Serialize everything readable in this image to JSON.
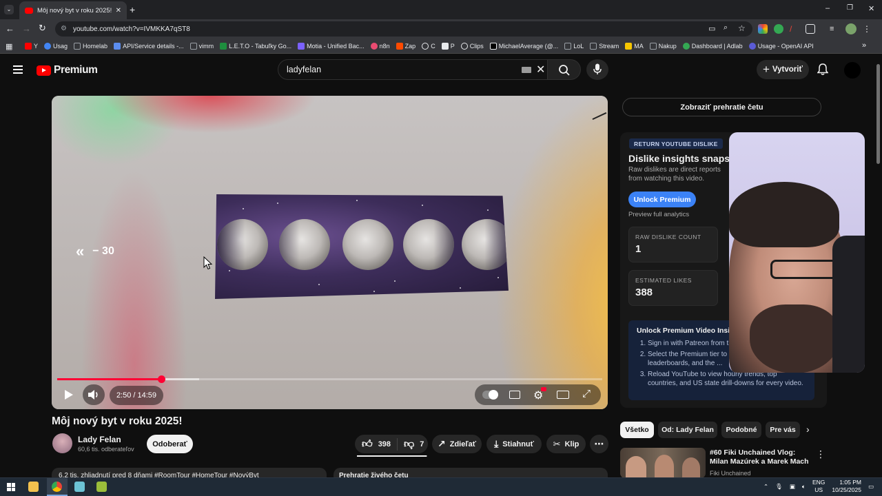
{
  "browser": {
    "tab_title": "Môj nový byt v roku 2025! - YouTube",
    "url": "youtube.com/watch?v=IVMKKA7qST8",
    "bookmarks": [
      {
        "label": "Y",
        "color": "#ff0000"
      },
      {
        "label": "Usag",
        "color": "#4285f4"
      },
      {
        "label": "Homelab",
        "color": "#9aa0a6"
      },
      {
        "label": "API/Service details -...",
        "color": "#5b8def"
      },
      {
        "label": "vimm",
        "color": "#9aa0a6"
      },
      {
        "label": "L.E.T.O - Tabuľky Go...",
        "color": "#1e8e3e"
      },
      {
        "label": "Motia - Unified Bac...",
        "color": "#7b61ff"
      },
      {
        "label": "n8n",
        "color": "#ea4b71"
      },
      {
        "label": "Zap",
        "color": "#ff4a00"
      },
      {
        "label": "C",
        "color": "#e8eaed"
      },
      {
        "label": "P",
        "color": "#e8eaed"
      },
      {
        "label": "Clips",
        "color": "#e8eaed"
      },
      {
        "label": "MichaelAverage (@...",
        "color": "#e8eaed"
      },
      {
        "label": "LoL",
        "color": "#9aa0a6"
      },
      {
        "label": "Stream",
        "color": "#9aa0a6"
      },
      {
        "label": "MA",
        "color": "#f7c600"
      },
      {
        "label": "Nakup",
        "color": "#9aa0a6"
      },
      {
        "label": "Dashboard | Adlab",
        "color": "#34a853"
      },
      {
        "label": "Usage - OpenAI API",
        "color": "#5b5bd6"
      }
    ]
  },
  "youtube": {
    "logo_text": "Premium",
    "search_value": "ladyfelan",
    "create_label": "Vytvoriť"
  },
  "player": {
    "skip_label": "− 30",
    "time": "2:50 / 14:59",
    "progress_fraction": 0.191,
    "buffered_fraction": 0.26
  },
  "video": {
    "title": "Môj nový byt v roku 2025!",
    "channel": "Lady Felan",
    "subscribers": "60,6 tis. odberateľov",
    "subscribe_label": "Odoberať",
    "likes": "398",
    "dislikes": "7",
    "share_label": "Zdieľať",
    "download_label": "Stiahnuť",
    "clip_label": "Klip",
    "description_snippet": "6,2 tis. zhliadnutí  pred 8 dňami  #RoomTour #HomeTour #NovýByt",
    "chat_replay_snippet": "Prehratie živého četu"
  },
  "sidebar": {
    "show_chat_label": "Zobraziť prehratie četu",
    "ryd_badge": "RETURN YOUTUBE DISLIKE",
    "ryd_title": "Dislike insights snapshot",
    "ryd_subtitle": "Raw dislikes are direct reports from watching this video.",
    "unlock_label": "Unlock Premium",
    "preview_label": "Preview full analytics",
    "raw_dislike_label": "RAW DISLIKE COUNT",
    "raw_dislike_value": "1",
    "est_likes_label": "ESTIMATED LIKES",
    "est_likes_value": "388",
    "insights_title": "Unlock Premium Video Insights",
    "insights_steps": [
      "Sign in with Patreon from the extension popup.",
      "Select the Premium tier to enable country leaderboards, and the ...",
      "Reload YouTube to view hourly trends, top countries, and US state drill-downs for every video."
    ],
    "chips": [
      "Všetko",
      "Od: Lady Felan",
      "Podobné",
      "Pre vás"
    ],
    "rec_title": "#60 Fiki Unchained Vlog: Milan Mazúrek a Marek Mach",
    "rec_channel": "Fiki Unchained"
  },
  "taskbar": {
    "lang_top": "ENG",
    "lang_bottom": "US",
    "time": "1:05 PM",
    "date": "10/25/2025"
  }
}
